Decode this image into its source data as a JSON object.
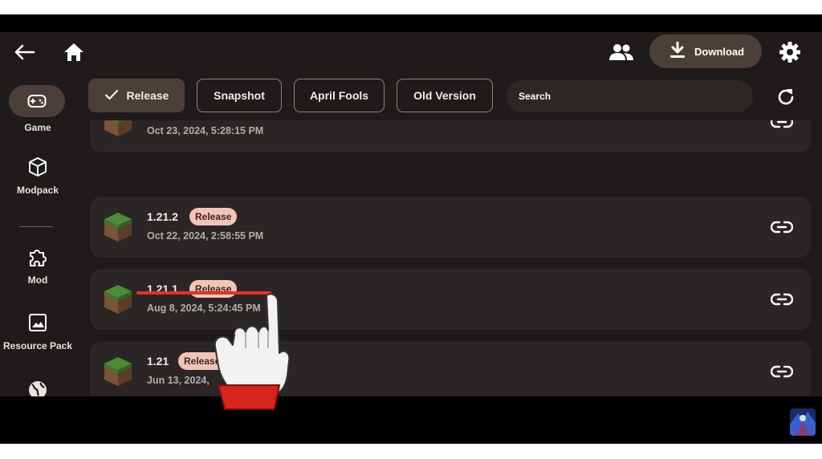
{
  "toolbar": {
    "download_label": "Download"
  },
  "sidebar": {
    "items": [
      {
        "label": "Game",
        "icon": "gamepad-icon"
      },
      {
        "label": "Modpack",
        "icon": "cube-icon"
      },
      {
        "label": "Mod",
        "icon": "puzzle-icon"
      },
      {
        "label": "Resource Pack",
        "icon": "image-icon"
      },
      {
        "label": "",
        "icon": "globe-icon"
      }
    ]
  },
  "filters": {
    "chips": [
      {
        "label": "Release",
        "selected": true
      },
      {
        "label": "Snapshot",
        "selected": false
      },
      {
        "label": "April Fools",
        "selected": false
      },
      {
        "label": "Old Version",
        "selected": false
      }
    ],
    "search_placeholder": "Search"
  },
  "versions": [
    {
      "name": "",
      "badge": "",
      "date": "Oct 23, 2024, 5:28:15 PM"
    },
    {
      "name": "1.21.2",
      "badge": "Release",
      "date": "Oct 22, 2024, 2:58:55 PM"
    },
    {
      "name": "1.21.1",
      "badge": "Release",
      "date": "Aug 8, 2024, 5:24:45 PM"
    },
    {
      "name": "1.21",
      "badge": "Release",
      "date": "Jun 13, 2024,"
    }
  ],
  "colors": {
    "background": "#1e1b1a",
    "card": "#2a2625",
    "accent": "#4b3f3a",
    "badge": "#f2c4b8",
    "highlight_underline": "#e3312c"
  }
}
